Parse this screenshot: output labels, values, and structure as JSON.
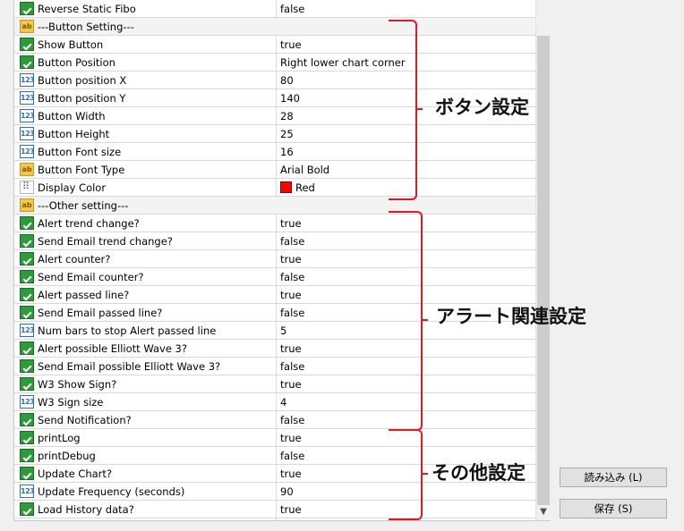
{
  "rows": [
    {
      "icon": "bool",
      "name": "Reverse Static Fibo",
      "value": "false"
    },
    {
      "icon": "str",
      "name": "---Button Setting---",
      "value": "",
      "sep": true
    },
    {
      "icon": "bool",
      "name": "Show Button",
      "value": "true"
    },
    {
      "icon": "bool",
      "name": "Button Position",
      "value": "Right lower chart corner"
    },
    {
      "icon": "num",
      "name": "Button position X",
      "value": "80"
    },
    {
      "icon": "num",
      "name": "Button position Y",
      "value": "140"
    },
    {
      "icon": "num",
      "name": "Button Width",
      "value": "28"
    },
    {
      "icon": "num",
      "name": "Button Height",
      "value": "25"
    },
    {
      "icon": "num",
      "name": "Button Font size",
      "value": "16"
    },
    {
      "icon": "str",
      "name": "Button Font Type",
      "value": "Arial Bold"
    },
    {
      "icon": "color",
      "name": "Display Color",
      "value": "Red",
      "swatch": "#ff0000"
    },
    {
      "icon": "str",
      "name": "---Other setting---",
      "value": "",
      "sep": true
    },
    {
      "icon": "bool",
      "name": "Alert trend change?",
      "value": "true"
    },
    {
      "icon": "bool",
      "name": "Send Email trend change?",
      "value": "false"
    },
    {
      "icon": "bool",
      "name": "Alert counter?",
      "value": "true"
    },
    {
      "icon": "bool",
      "name": "Send Email counter?",
      "value": "false"
    },
    {
      "icon": "bool",
      "name": "Alert passed line?",
      "value": "true"
    },
    {
      "icon": "bool",
      "name": "Send Email passed line?",
      "value": "false"
    },
    {
      "icon": "num",
      "name": "Num bars to stop Alert passed line",
      "value": "5"
    },
    {
      "icon": "bool",
      "name": "Alert possible Elliott Wave 3?",
      "value": "true"
    },
    {
      "icon": "bool",
      "name": "Send Email possible Elliott Wave 3?",
      "value": "false"
    },
    {
      "icon": "bool",
      "name": "W3 Show Sign?",
      "value": "true"
    },
    {
      "icon": "num",
      "name": "W3 Sign size",
      "value": "4"
    },
    {
      "icon": "bool",
      "name": "Send Notification?",
      "value": "false"
    },
    {
      "icon": "bool",
      "name": "printLog",
      "value": "true"
    },
    {
      "icon": "bool",
      "name": "printDebug",
      "value": "false"
    },
    {
      "icon": "bool",
      "name": "Update Chart?",
      "value": "true"
    },
    {
      "icon": "num",
      "name": "Update Frequency (seconds)",
      "value": "90"
    },
    {
      "icon": "bool",
      "name": "Load History data?",
      "value": "true"
    }
  ],
  "icon_text": {
    "num": "123",
    "str": "ab"
  },
  "buttons": {
    "load_label": "読み込み (L)",
    "save_label": "保存 (S)"
  },
  "annotations": {
    "button_settings": "ボタン設定",
    "alert_settings": "アラート関連設定",
    "other_settings": "その他設定"
  },
  "colors": {
    "bracket": "#e8161f",
    "swatch_red": "#ff0000"
  }
}
